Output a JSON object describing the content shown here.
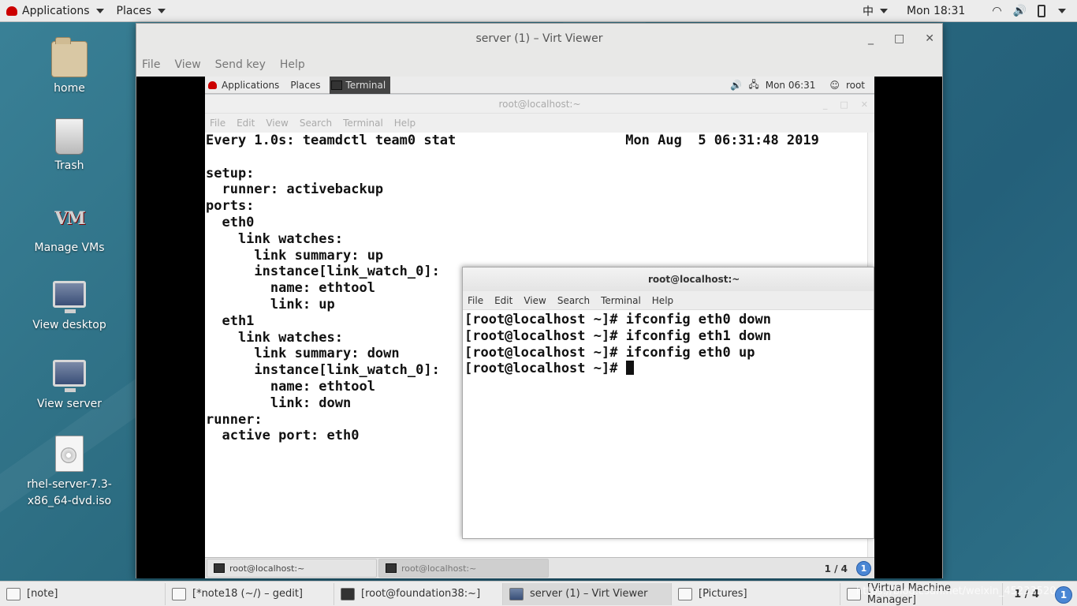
{
  "host_top_bar": {
    "applications": "Applications",
    "places": "Places",
    "input_method": "中",
    "clock": "Mon 18:31"
  },
  "desktop_icons": [
    {
      "label": "home",
      "icon": "home-folder-icon"
    },
    {
      "label": "Trash",
      "icon": "trash-icon"
    },
    {
      "label": "Manage VMs",
      "icon": "virt-manager-icon"
    },
    {
      "label": "View desktop",
      "icon": "monitor-icon"
    },
    {
      "label": "View server",
      "icon": "monitor-icon"
    },
    {
      "label": "rhel-server-7.3-\nx86_64-dvd.iso",
      "icon": "disc-image-icon"
    }
  ],
  "virt_viewer": {
    "title": "server (1) – Virt Viewer",
    "minimize": "_",
    "maximize": "□",
    "close": "✕",
    "menu": [
      "File",
      "View",
      "Send key",
      "Help"
    ]
  },
  "guest_top_bar": {
    "applications": "Applications",
    "places": "Places",
    "terminal": "Terminal",
    "clock": "Mon 06:31",
    "user": "root"
  },
  "back_terminal": {
    "title": "root@localhost:~",
    "menu": [
      "File",
      "Edit",
      "View",
      "Search",
      "Terminal",
      "Help"
    ],
    "lines": [
      "Every 1.0s: teamdctl team0 stat                     Mon Aug  5 06:31:48 2019",
      "",
      "setup:",
      "  runner: activebackup",
      "ports:",
      "  eth0",
      "    link watches:",
      "      link summary: up",
      "      instance[link_watch_0]:",
      "        name: ethtool",
      "        link: up",
      "  eth1",
      "    link watches:",
      "      link summary: down",
      "      instance[link_watch_0]:",
      "        name: ethtool",
      "        link: down",
      "runner:",
      "  active port: eth0"
    ]
  },
  "front_terminal": {
    "title": "root@localhost:~",
    "menu": [
      "File",
      "Edit",
      "View",
      "Search",
      "Terminal",
      "Help"
    ],
    "lines": [
      "[root@localhost ~]# ifconfig eth0 down",
      "[root@localhost ~]# ifconfig eth1 down",
      "[root@localhost ~]# ifconfig eth0 up"
    ],
    "prompt": "[root@localhost ~]# "
  },
  "guest_taskbar": {
    "tasks": [
      "root@localhost:~",
      "root@localhost:~"
    ],
    "pager": "1 / 4",
    "info": "1"
  },
  "host_taskbar": {
    "tasks": [
      {
        "label": "[note]",
        "icon": "note-icon",
        "active": false
      },
      {
        "label": "[*note18 (~/) – gedit]",
        "icon": "gedit-icon",
        "active": false
      },
      {
        "label": "[root@foundation38:~]",
        "icon": "terminal-icon",
        "active": false
      },
      {
        "label": "server (1) – Virt Viewer",
        "icon": "monitor-icon",
        "active": true
      },
      {
        "label": "[Pictures]",
        "icon": "folder-icon",
        "active": false
      },
      {
        "label": "[Virtual Machine Manager]",
        "icon": "virt-manager-icon",
        "active": false
      }
    ],
    "pager": "1 / 4",
    "watermark": "https://blog.csdn.net/weixin_45233520",
    "info": "1"
  }
}
